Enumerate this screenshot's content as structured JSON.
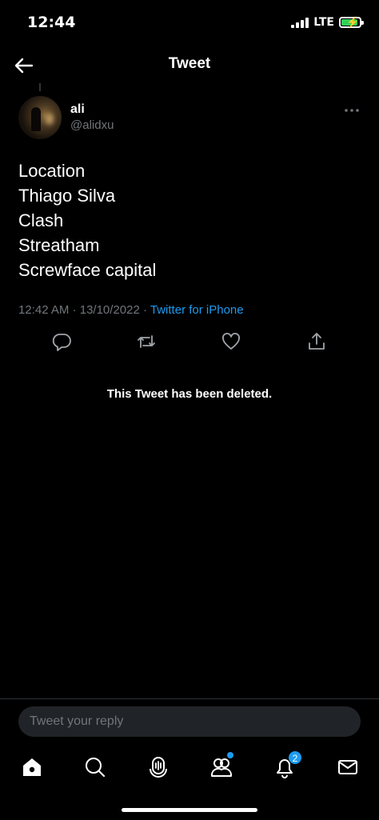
{
  "status_bar": {
    "time": "12:44",
    "network": "LTE",
    "battery_color": "#30d158"
  },
  "header": {
    "title": "Tweet",
    "back_icon": "arrow-left-icon"
  },
  "tweet": {
    "author": {
      "name": "ali",
      "handle": "@alidxu"
    },
    "lines": [
      "Location",
      "Thiago Silva",
      "Clash",
      "Streatham",
      "Screwface capital"
    ],
    "time": "12:42 AM",
    "date": "13/10/2022",
    "separator": "·",
    "source": "Twitter for iPhone"
  },
  "actions": [
    "reply-icon",
    "retweet-icon",
    "like-icon",
    "share-icon"
  ],
  "deleted_notice": "This Tweet has been deleted.",
  "reply": {
    "placeholder": "Tweet your reply"
  },
  "tabbar": {
    "tabs": [
      "home-icon",
      "search-icon",
      "spaces-icon",
      "communities-icon",
      "notifications-icon",
      "messages-icon"
    ],
    "notifications_badge": "2"
  },
  "colors": {
    "accent": "#1d9bf0",
    "background": "#000000",
    "muted": "#71767b"
  }
}
